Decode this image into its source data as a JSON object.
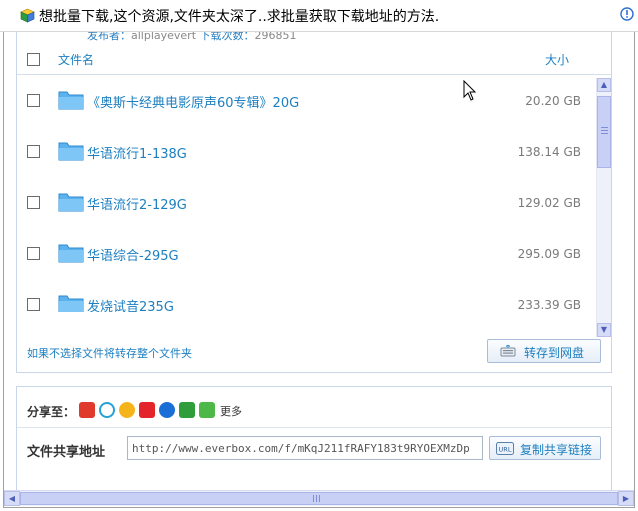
{
  "window": {
    "title": "想批量下载,这个资源,文件夹太深了..求批量获取下载地址的方法.",
    "app_icon": "cube-icon",
    "status_icon": "warning-icon"
  },
  "file_panel": {
    "publisher_label": "发布者：",
    "publisher_name": "allplayevert",
    "downloads_label": "下载次数：",
    "downloads_value": "296851",
    "header": {
      "name": "文件名",
      "size": "大小"
    },
    "files": [
      {
        "name": "《奥斯卡经典电影原声60专辑》20G",
        "size": "20.20 GB"
      },
      {
        "name": "华语流行1-138G",
        "size": "138.14 GB"
      },
      {
        "name": "华语流行2-129G",
        "size": "129.02 GB"
      },
      {
        "name": "华语综合-295G",
        "size": "295.09 GB"
      },
      {
        "name": "发烧试音235G",
        "size": "233.39 GB"
      }
    ],
    "hint": "如果不选择文件将转存整个文件夹",
    "save_button": "转存到网盘"
  },
  "share_panel": {
    "share_label": "分享至：",
    "share_icons": [
      "weibo-icon",
      "tencent-weibo-icon",
      "qzone-icon",
      "renren-icon",
      "kaixin-icon",
      "douban-icon",
      "plus-icon"
    ],
    "more": "更多",
    "address_label": "文件共享地址",
    "address_value": "http://www.everbox.com/f/mKqJ211fRAFY183t9RYOEXMzDp",
    "copy_button": "复制共享链接"
  },
  "colors": {
    "link": "#1c7fc0",
    "scrollbar": "#c9d0f5",
    "border": "#c8d7e8"
  }
}
